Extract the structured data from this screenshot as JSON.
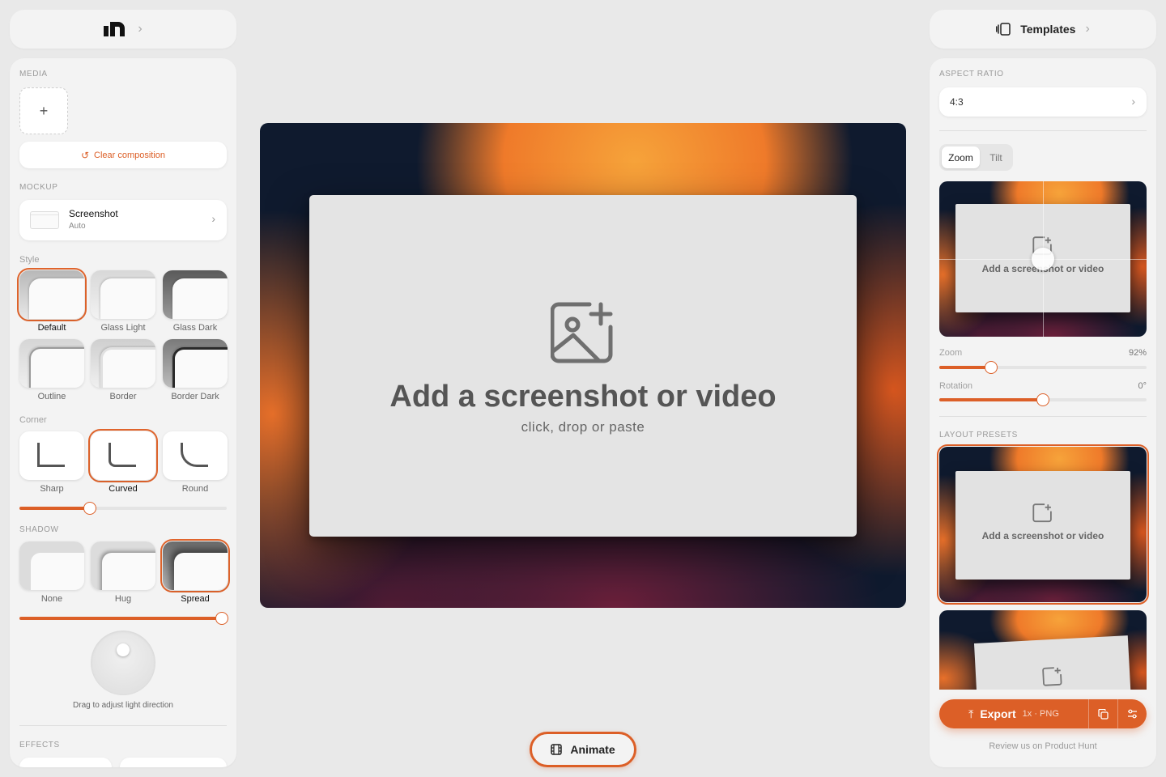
{
  "colors": {
    "accent": "#dc5f27",
    "background": "#e9e9e9",
    "panel": "#f3f3f3"
  },
  "left": {
    "logo_icon": "brand-logo-icon",
    "media_label": "MEDIA",
    "add_media_symbol": "+",
    "clear_label": "Clear composition",
    "mockup_label": "MOCKUP",
    "mockup": {
      "title": "Screenshot",
      "subtitle": "Auto"
    },
    "style_label": "Style",
    "styles": [
      "Default",
      "Glass Light",
      "Glass Dark",
      "Outline",
      "Border",
      "Border Dark"
    ],
    "style_selected": "Default",
    "corner_label": "Corner",
    "corners": [
      "Sharp",
      "Curved",
      "Round"
    ],
    "corner_selected": "Curved",
    "corner_value": 0.34,
    "shadow_label": "SHADOW",
    "shadows": [
      "None",
      "Hug",
      "Spread"
    ],
    "shadow_selected": "Spread",
    "shadow_value": 1.0,
    "light_hint": "Drag to adjust light direction",
    "effects_label": "EFFECTS"
  },
  "canvas": {
    "title": "Add a screenshot or video",
    "subtitle": "click, drop or paste"
  },
  "animate_label": "Animate",
  "right": {
    "templates_label": "Templates",
    "aspect_label": "ASPECT RATIO",
    "aspect_value": "4:3",
    "tabs": [
      "Zoom",
      "Tilt"
    ],
    "tab_selected": "Zoom",
    "preview_text": "Add a screenshot or video",
    "preview_subtext": "click, drop or paste",
    "zoom_label": "Zoom",
    "zoom_value": "92%",
    "zoom_fraction": 0.25,
    "rotation_label": "Rotation",
    "rotation_value": "0°",
    "rotation_fraction": 0.5,
    "presets_label": "LAYOUT PRESETS",
    "export_label": "Export",
    "export_meta": "1x · PNG",
    "review_text": "Review us on Product Hunt"
  }
}
